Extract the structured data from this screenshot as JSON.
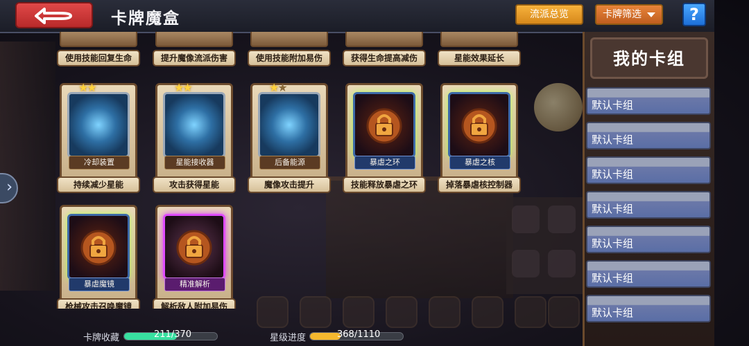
{
  "header": {
    "title": "卡牌魔盒",
    "overview_label": "流派总览",
    "filter_label": "卡牌筛选",
    "help_label": "?"
  },
  "top_row": [
    {
      "desc": "使用技能回复生命"
    },
    {
      "desc": "提升魔像流派伤害"
    },
    {
      "desc": "使用技能附加易伤"
    },
    {
      "desc": "获得生命提高减伤"
    },
    {
      "desc": "星能效果延长"
    }
  ],
  "cards": [
    {
      "name": "冷却装置",
      "desc": "持续减少星能",
      "stars": 2,
      "art": "tech"
    },
    {
      "name": "星能接收器",
      "desc": "攻击获得星能",
      "stars": 2,
      "art": "tech"
    },
    {
      "name": "后备能源",
      "desc": "魔像攻击提升",
      "stars": 1,
      "art": "tech"
    },
    {
      "name": "暴虐之环",
      "desc": "技能释放暴虐之环",
      "stars": 0,
      "art": "dark"
    },
    {
      "name": "暴虐之核",
      "desc": "掉落暴虐核控制器",
      "stars": 0,
      "art": "dark"
    },
    {
      "name": "暴虐魔镜",
      "desc": "枪械攻击召唤魔镜",
      "stars": 0,
      "art": "dark"
    },
    {
      "name": "精准解析",
      "desc": "解析敌人附加易伤",
      "stars": 0,
      "art": "purple"
    }
  ],
  "deck_panel": {
    "title": "我的卡组",
    "items": [
      "默认卡组",
      "默认卡组",
      "默认卡组",
      "默认卡组",
      "默认卡组",
      "默认卡组",
      "默认卡组"
    ]
  },
  "progress": {
    "collection_label": "卡牌收藏",
    "collection_text": "211/370",
    "collection_value": 211,
    "collection_max": 370,
    "star_label": "星级进度",
    "star_text": "368/1110",
    "star_value": 368,
    "star_max": 1110
  },
  "colors": {
    "collection_fill": "#38e0a0",
    "star_fill": "#f5b82e"
  }
}
